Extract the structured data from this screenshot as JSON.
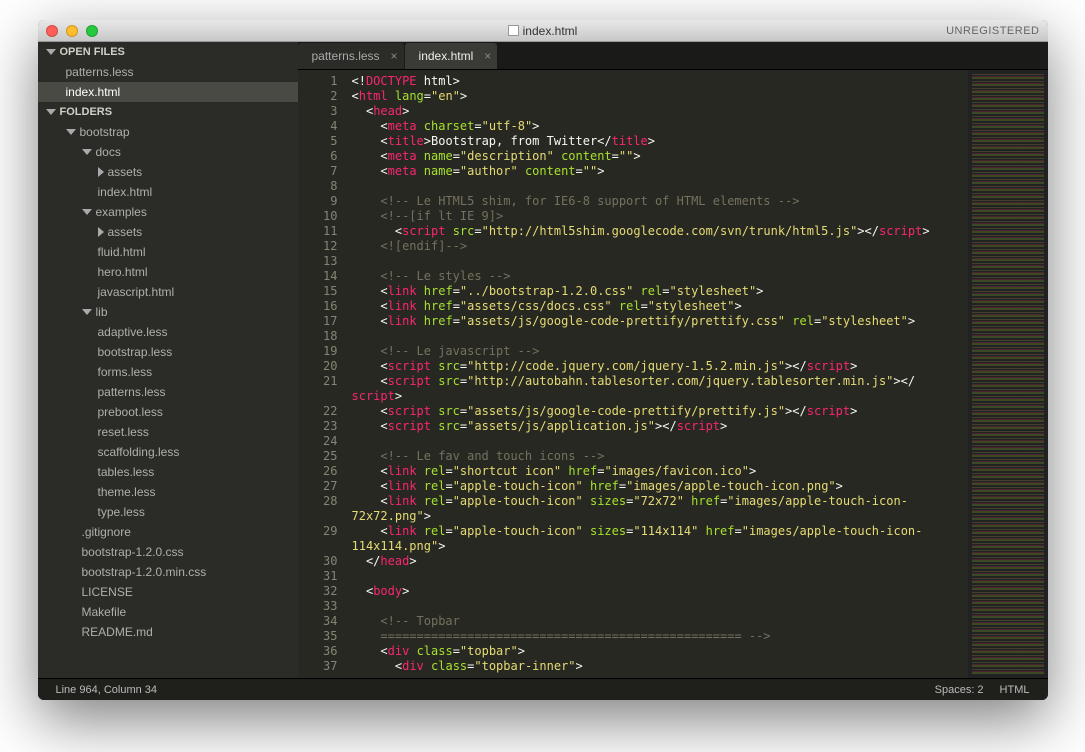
{
  "window": {
    "title": "index.html",
    "unregistered": "UNREGISTERED"
  },
  "sidebar": {
    "open_files_header": "OPEN FILES",
    "open_files": [
      "patterns.less",
      "index.html"
    ],
    "open_files_selected": 1,
    "folders_header": "FOLDERS",
    "tree": [
      {
        "depth": 1,
        "type": "folder",
        "open": true,
        "name": "bootstrap"
      },
      {
        "depth": 2,
        "type": "folder",
        "open": true,
        "name": "docs"
      },
      {
        "depth": 3,
        "type": "folder",
        "open": false,
        "name": "assets"
      },
      {
        "depth": 3,
        "type": "file",
        "name": "index.html"
      },
      {
        "depth": 2,
        "type": "folder",
        "open": true,
        "name": "examples"
      },
      {
        "depth": 3,
        "type": "folder",
        "open": false,
        "name": "assets"
      },
      {
        "depth": 3,
        "type": "file",
        "name": "fluid.html"
      },
      {
        "depth": 3,
        "type": "file",
        "name": "hero.html"
      },
      {
        "depth": 3,
        "type": "file",
        "name": "javascript.html"
      },
      {
        "depth": 2,
        "type": "folder",
        "open": true,
        "name": "lib"
      },
      {
        "depth": 3,
        "type": "file",
        "name": "adaptive.less"
      },
      {
        "depth": 3,
        "type": "file",
        "name": "bootstrap.less"
      },
      {
        "depth": 3,
        "type": "file",
        "name": "forms.less"
      },
      {
        "depth": 3,
        "type": "file",
        "name": "patterns.less"
      },
      {
        "depth": 3,
        "type": "file",
        "name": "preboot.less"
      },
      {
        "depth": 3,
        "type": "file",
        "name": "reset.less"
      },
      {
        "depth": 3,
        "type": "file",
        "name": "scaffolding.less"
      },
      {
        "depth": 3,
        "type": "file",
        "name": "tables.less"
      },
      {
        "depth": 3,
        "type": "file",
        "name": "theme.less"
      },
      {
        "depth": 3,
        "type": "file",
        "name": "type.less"
      },
      {
        "depth": 2,
        "type": "file",
        "name": ".gitignore"
      },
      {
        "depth": 2,
        "type": "file",
        "name": "bootstrap-1.2.0.css"
      },
      {
        "depth": 2,
        "type": "file",
        "name": "bootstrap-1.2.0.min.css"
      },
      {
        "depth": 2,
        "type": "file",
        "name": "LICENSE"
      },
      {
        "depth": 2,
        "type": "file",
        "name": "Makefile"
      },
      {
        "depth": 2,
        "type": "file",
        "name": "README.md"
      }
    ]
  },
  "tabs": [
    {
      "label": "patterns.less",
      "active": false
    },
    {
      "label": "index.html",
      "active": true
    }
  ],
  "editor": {
    "first_line": 1,
    "last_line": 37,
    "lines": [
      [
        {
          "c": "ang",
          "t": "<!"
        },
        {
          "c": "tag",
          "t": "DOCTYPE"
        },
        {
          "c": "txt",
          "t": " html"
        },
        {
          "c": "ang",
          "t": ">"
        }
      ],
      [
        {
          "c": "ang",
          "t": "<"
        },
        {
          "c": "tag",
          "t": "html"
        },
        {
          "c": "txt",
          "t": " "
        },
        {
          "c": "attr",
          "t": "lang"
        },
        {
          "c": "ang",
          "t": "="
        },
        {
          "c": "str",
          "t": "\"en\""
        },
        {
          "c": "ang",
          "t": ">"
        }
      ],
      [
        {
          "c": "txt",
          "t": "  "
        },
        {
          "c": "ang",
          "t": "<"
        },
        {
          "c": "tag",
          "t": "head"
        },
        {
          "c": "ang",
          "t": ">"
        }
      ],
      [
        {
          "c": "txt",
          "t": "    "
        },
        {
          "c": "ang",
          "t": "<"
        },
        {
          "c": "tag",
          "t": "meta"
        },
        {
          "c": "txt",
          "t": " "
        },
        {
          "c": "attr",
          "t": "charset"
        },
        {
          "c": "ang",
          "t": "="
        },
        {
          "c": "str",
          "t": "\"utf-8\""
        },
        {
          "c": "ang",
          "t": ">"
        }
      ],
      [
        {
          "c": "txt",
          "t": "    "
        },
        {
          "c": "ang",
          "t": "<"
        },
        {
          "c": "tag",
          "t": "title"
        },
        {
          "c": "ang",
          "t": ">"
        },
        {
          "c": "txt",
          "t": "Bootstrap, from Twitter"
        },
        {
          "c": "ang",
          "t": "</"
        },
        {
          "c": "tag",
          "t": "title"
        },
        {
          "c": "ang",
          "t": ">"
        }
      ],
      [
        {
          "c": "txt",
          "t": "    "
        },
        {
          "c": "ang",
          "t": "<"
        },
        {
          "c": "tag",
          "t": "meta"
        },
        {
          "c": "txt",
          "t": " "
        },
        {
          "c": "attr",
          "t": "name"
        },
        {
          "c": "ang",
          "t": "="
        },
        {
          "c": "str",
          "t": "\"description\""
        },
        {
          "c": "txt",
          "t": " "
        },
        {
          "c": "attr",
          "t": "content"
        },
        {
          "c": "ang",
          "t": "="
        },
        {
          "c": "str",
          "t": "\"\""
        },
        {
          "c": "ang",
          "t": ">"
        }
      ],
      [
        {
          "c": "txt",
          "t": "    "
        },
        {
          "c": "ang",
          "t": "<"
        },
        {
          "c": "tag",
          "t": "meta"
        },
        {
          "c": "txt",
          "t": " "
        },
        {
          "c": "attr",
          "t": "name"
        },
        {
          "c": "ang",
          "t": "="
        },
        {
          "c": "str",
          "t": "\"author\""
        },
        {
          "c": "txt",
          "t": " "
        },
        {
          "c": "attr",
          "t": "content"
        },
        {
          "c": "ang",
          "t": "="
        },
        {
          "c": "str",
          "t": "\"\""
        },
        {
          "c": "ang",
          "t": ">"
        }
      ],
      [],
      [
        {
          "c": "txt",
          "t": "    "
        },
        {
          "c": "com",
          "t": "<!-- Le HTML5 shim, for IE6-8 support of HTML elements -->"
        }
      ],
      [
        {
          "c": "txt",
          "t": "    "
        },
        {
          "c": "com",
          "t": "<!--[if lt IE 9]>"
        }
      ],
      [
        {
          "c": "txt",
          "t": "      "
        },
        {
          "c": "ang",
          "t": "<"
        },
        {
          "c": "tag",
          "t": "script"
        },
        {
          "c": "txt",
          "t": " "
        },
        {
          "c": "attr",
          "t": "src"
        },
        {
          "c": "ang",
          "t": "="
        },
        {
          "c": "str",
          "t": "\"http://html5shim.googlecode.com/svn/trunk/html5.js\""
        },
        {
          "c": "ang",
          "t": "></"
        },
        {
          "c": "tag",
          "t": "script"
        },
        {
          "c": "ang",
          "t": ">"
        }
      ],
      [
        {
          "c": "txt",
          "t": "    "
        },
        {
          "c": "com",
          "t": "<![endif]-->"
        }
      ],
      [],
      [
        {
          "c": "txt",
          "t": "    "
        },
        {
          "c": "com",
          "t": "<!-- Le styles -->"
        }
      ],
      [
        {
          "c": "txt",
          "t": "    "
        },
        {
          "c": "ang",
          "t": "<"
        },
        {
          "c": "tag",
          "t": "link"
        },
        {
          "c": "txt",
          "t": " "
        },
        {
          "c": "attr",
          "t": "href"
        },
        {
          "c": "ang",
          "t": "="
        },
        {
          "c": "str",
          "t": "\"../bootstrap-1.2.0.css\""
        },
        {
          "c": "txt",
          "t": " "
        },
        {
          "c": "attr",
          "t": "rel"
        },
        {
          "c": "ang",
          "t": "="
        },
        {
          "c": "str",
          "t": "\"stylesheet\""
        },
        {
          "c": "ang",
          "t": ">"
        }
      ],
      [
        {
          "c": "txt",
          "t": "    "
        },
        {
          "c": "ang",
          "t": "<"
        },
        {
          "c": "tag",
          "t": "link"
        },
        {
          "c": "txt",
          "t": " "
        },
        {
          "c": "attr",
          "t": "href"
        },
        {
          "c": "ang",
          "t": "="
        },
        {
          "c": "str",
          "t": "\"assets/css/docs.css\""
        },
        {
          "c": "txt",
          "t": " "
        },
        {
          "c": "attr",
          "t": "rel"
        },
        {
          "c": "ang",
          "t": "="
        },
        {
          "c": "str",
          "t": "\"stylesheet\""
        },
        {
          "c": "ang",
          "t": ">"
        }
      ],
      [
        {
          "c": "txt",
          "t": "    "
        },
        {
          "c": "ang",
          "t": "<"
        },
        {
          "c": "tag",
          "t": "link"
        },
        {
          "c": "txt",
          "t": " "
        },
        {
          "c": "attr",
          "t": "href"
        },
        {
          "c": "ang",
          "t": "="
        },
        {
          "c": "str",
          "t": "\"assets/js/google-code-prettify/prettify.css\""
        },
        {
          "c": "txt",
          "t": " "
        },
        {
          "c": "attr",
          "t": "rel"
        },
        {
          "c": "ang",
          "t": "="
        },
        {
          "c": "str",
          "t": "\"stylesheet\""
        },
        {
          "c": "ang",
          "t": ">"
        }
      ],
      [],
      [
        {
          "c": "txt",
          "t": "    "
        },
        {
          "c": "com",
          "t": "<!-- Le javascript -->"
        }
      ],
      [
        {
          "c": "txt",
          "t": "    "
        },
        {
          "c": "ang",
          "t": "<"
        },
        {
          "c": "tag",
          "t": "script"
        },
        {
          "c": "txt",
          "t": " "
        },
        {
          "c": "attr",
          "t": "src"
        },
        {
          "c": "ang",
          "t": "="
        },
        {
          "c": "str",
          "t": "\"http://code.jquery.com/jquery-1.5.2.min.js\""
        },
        {
          "c": "ang",
          "t": "></"
        },
        {
          "c": "tag",
          "t": "script"
        },
        {
          "c": "ang",
          "t": ">"
        }
      ],
      [
        {
          "c": "txt",
          "t": "    "
        },
        {
          "c": "ang",
          "t": "<"
        },
        {
          "c": "tag",
          "t": "script"
        },
        {
          "c": "txt",
          "t": " "
        },
        {
          "c": "attr",
          "t": "src"
        },
        {
          "c": "ang",
          "t": "="
        },
        {
          "c": "str",
          "t": "\"http://autobahn.tablesorter.com/jquery.tablesorter.min.js\""
        },
        {
          "c": "ang",
          "t": "></"
        },
        {
          "c": "tag",
          "t": "\nscript"
        },
        {
          "c": "ang",
          "t": ">"
        }
      ],
      [
        {
          "c": "txt",
          "t": "    "
        },
        {
          "c": "ang",
          "t": "<"
        },
        {
          "c": "tag",
          "t": "script"
        },
        {
          "c": "txt",
          "t": " "
        },
        {
          "c": "attr",
          "t": "src"
        },
        {
          "c": "ang",
          "t": "="
        },
        {
          "c": "str",
          "t": "\"assets/js/google-code-prettify/prettify.js\""
        },
        {
          "c": "ang",
          "t": "></"
        },
        {
          "c": "tag",
          "t": "script"
        },
        {
          "c": "ang",
          "t": ">"
        }
      ],
      [
        {
          "c": "txt",
          "t": "    "
        },
        {
          "c": "ang",
          "t": "<"
        },
        {
          "c": "tag",
          "t": "script"
        },
        {
          "c": "txt",
          "t": " "
        },
        {
          "c": "attr",
          "t": "src"
        },
        {
          "c": "ang",
          "t": "="
        },
        {
          "c": "str",
          "t": "\"assets/js/application.js\""
        },
        {
          "c": "ang",
          "t": "></"
        },
        {
          "c": "tag",
          "t": "script"
        },
        {
          "c": "ang",
          "t": ">"
        }
      ],
      [],
      [
        {
          "c": "txt",
          "t": "    "
        },
        {
          "c": "com",
          "t": "<!-- Le fav and touch icons -->"
        }
      ],
      [
        {
          "c": "txt",
          "t": "    "
        },
        {
          "c": "ang",
          "t": "<"
        },
        {
          "c": "tag",
          "t": "link"
        },
        {
          "c": "txt",
          "t": " "
        },
        {
          "c": "attr",
          "t": "rel"
        },
        {
          "c": "ang",
          "t": "="
        },
        {
          "c": "str",
          "t": "\"shortcut icon\""
        },
        {
          "c": "txt",
          "t": " "
        },
        {
          "c": "attr",
          "t": "href"
        },
        {
          "c": "ang",
          "t": "="
        },
        {
          "c": "str",
          "t": "\"images/favicon.ico\""
        },
        {
          "c": "ang",
          "t": ">"
        }
      ],
      [
        {
          "c": "txt",
          "t": "    "
        },
        {
          "c": "ang",
          "t": "<"
        },
        {
          "c": "tag",
          "t": "link"
        },
        {
          "c": "txt",
          "t": " "
        },
        {
          "c": "attr",
          "t": "rel"
        },
        {
          "c": "ang",
          "t": "="
        },
        {
          "c": "str",
          "t": "\"apple-touch-icon\""
        },
        {
          "c": "txt",
          "t": " "
        },
        {
          "c": "attr",
          "t": "href"
        },
        {
          "c": "ang",
          "t": "="
        },
        {
          "c": "str",
          "t": "\"images/apple-touch-icon.png\""
        },
        {
          "c": "ang",
          "t": ">"
        }
      ],
      [
        {
          "c": "txt",
          "t": "    "
        },
        {
          "c": "ang",
          "t": "<"
        },
        {
          "c": "tag",
          "t": "link"
        },
        {
          "c": "txt",
          "t": " "
        },
        {
          "c": "attr",
          "t": "rel"
        },
        {
          "c": "ang",
          "t": "="
        },
        {
          "c": "str",
          "t": "\"apple-touch-icon\""
        },
        {
          "c": "txt",
          "t": " "
        },
        {
          "c": "attr",
          "t": "sizes"
        },
        {
          "c": "ang",
          "t": "="
        },
        {
          "c": "str",
          "t": "\"72x72\""
        },
        {
          "c": "txt",
          "t": " "
        },
        {
          "c": "attr",
          "t": "href"
        },
        {
          "c": "ang",
          "t": "="
        },
        {
          "c": "str",
          "t": "\"images/apple-touch-icon-\n72x72.png\""
        },
        {
          "c": "ang",
          "t": ">"
        }
      ],
      [
        {
          "c": "txt",
          "t": "    "
        },
        {
          "c": "ang",
          "t": "<"
        },
        {
          "c": "tag",
          "t": "link"
        },
        {
          "c": "txt",
          "t": " "
        },
        {
          "c": "attr",
          "t": "rel"
        },
        {
          "c": "ang",
          "t": "="
        },
        {
          "c": "str",
          "t": "\"apple-touch-icon\""
        },
        {
          "c": "txt",
          "t": " "
        },
        {
          "c": "attr",
          "t": "sizes"
        },
        {
          "c": "ang",
          "t": "="
        },
        {
          "c": "str",
          "t": "\"114x114\""
        },
        {
          "c": "txt",
          "t": " "
        },
        {
          "c": "attr",
          "t": "href"
        },
        {
          "c": "ang",
          "t": "="
        },
        {
          "c": "str",
          "t": "\"images/apple-touch-icon-\n114x114.png\""
        },
        {
          "c": "ang",
          "t": ">"
        }
      ],
      [
        {
          "c": "txt",
          "t": "  "
        },
        {
          "c": "ang",
          "t": "</"
        },
        {
          "c": "tag",
          "t": "head"
        },
        {
          "c": "ang",
          "t": ">"
        }
      ],
      [],
      [
        {
          "c": "txt",
          "t": "  "
        },
        {
          "c": "ang",
          "t": "<"
        },
        {
          "c": "tag",
          "t": "body"
        },
        {
          "c": "ang",
          "t": ">"
        }
      ],
      [],
      [
        {
          "c": "txt",
          "t": "    "
        },
        {
          "c": "com",
          "t": "<!-- Topbar"
        }
      ],
      [
        {
          "c": "txt",
          "t": "    "
        },
        {
          "c": "com",
          "t": "================================================== -->"
        }
      ],
      [
        {
          "c": "txt",
          "t": "    "
        },
        {
          "c": "ang",
          "t": "<"
        },
        {
          "c": "tag",
          "t": "div"
        },
        {
          "c": "txt",
          "t": " "
        },
        {
          "c": "attr",
          "t": "class"
        },
        {
          "c": "ang",
          "t": "="
        },
        {
          "c": "str",
          "t": "\"topbar\""
        },
        {
          "c": "ang",
          "t": ">"
        }
      ],
      [
        {
          "c": "txt",
          "t": "      "
        },
        {
          "c": "ang",
          "t": "<"
        },
        {
          "c": "tag",
          "t": "div"
        },
        {
          "c": "txt",
          "t": " "
        },
        {
          "c": "attr",
          "t": "class"
        },
        {
          "c": "ang",
          "t": "="
        },
        {
          "c": "str",
          "t": "\"topbar-inner\""
        },
        {
          "c": "ang",
          "t": ">"
        }
      ]
    ]
  },
  "statusbar": {
    "position": "Line 964, Column 34",
    "spaces": "Spaces: 2",
    "syntax": "HTML"
  }
}
